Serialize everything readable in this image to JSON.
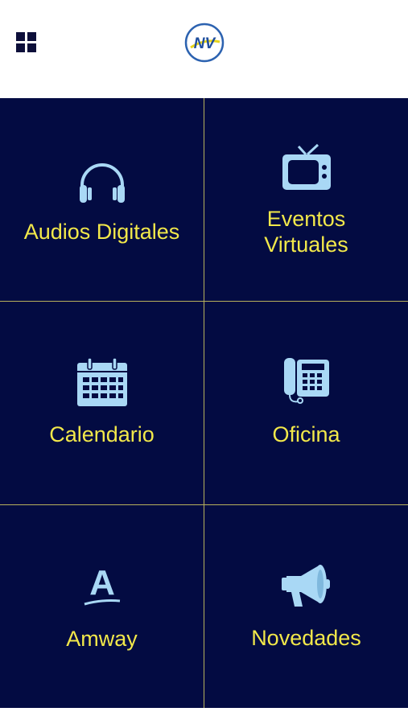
{
  "header": {
    "menu_icon": "grid-menu-icon",
    "logo_text": "NV"
  },
  "tiles": [
    {
      "label": "Audios Digitales",
      "icon": "headphones-icon"
    },
    {
      "label_line1": "Eventos",
      "label_line2": "Virtuales",
      "icon": "tv-icon"
    },
    {
      "label": "Calendario",
      "icon": "calendar-icon"
    },
    {
      "label": "Oficina",
      "icon": "phone-icon"
    },
    {
      "label": "Amway",
      "icon": "amway-logo-icon",
      "icon_letter": "A"
    },
    {
      "label": "Novedades",
      "icon": "megaphone-icon"
    }
  ],
  "colors": {
    "background": "#030b42",
    "label": "#f2e84a",
    "icon": "#a9d8f5",
    "divider": "#b8b15c"
  }
}
